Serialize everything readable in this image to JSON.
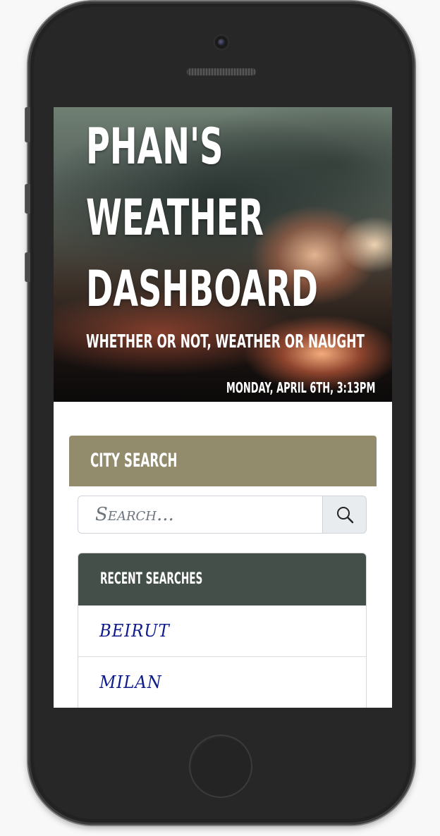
{
  "header": {
    "title": "Phan's Weather Dashboard",
    "subtitle": "Whether or not, weather or naught",
    "datetime": "Monday, April 6th, 3:13pm"
  },
  "city_search": {
    "title": "City Search",
    "placeholder": "Search...",
    "button_icon": "search-icon"
  },
  "recent_searches": {
    "title": "Recent Searches",
    "items": [
      {
        "label": "Beirut"
      },
      {
        "label": "Milan"
      }
    ]
  },
  "colors": {
    "city_search_header": "#928c6d",
    "recent_searches_header": "#434f48",
    "recent_link": "#0d1a8c"
  }
}
